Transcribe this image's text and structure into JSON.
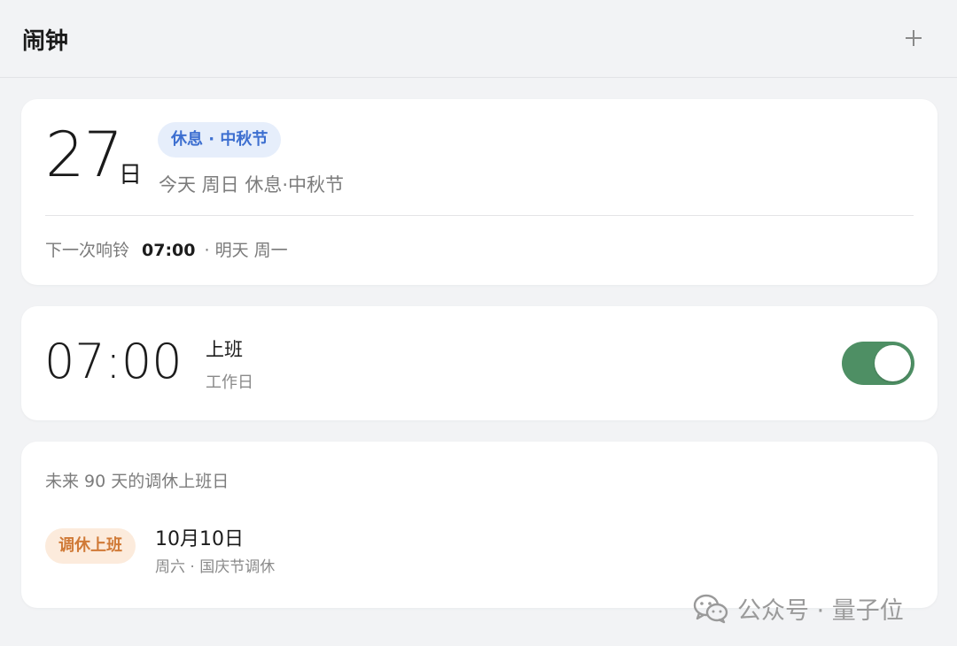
{
  "header": {
    "title": "闹钟",
    "add_icon": "plus-icon"
  },
  "today": {
    "day_number": "27",
    "day_suffix": "日",
    "badge": "休息 · 中秋节",
    "description": "今天 周日 休息·中秋节",
    "next_ring_label": "下一次响铃",
    "next_ring_time": "07:00",
    "next_ring_when": "· 明天 周一"
  },
  "alarm": {
    "time": "07:00",
    "label": "上班",
    "repeat": "工作日",
    "enabled": true,
    "toggle_color": "#4e8f64"
  },
  "makeup": {
    "heading": "未来 90 天的调休上班日",
    "items": [
      {
        "badge": "调休上班",
        "date": "10月10日",
        "detail": "周六 · 国庆节调休"
      }
    ]
  },
  "watermark": {
    "text": "公众号 · 量子位",
    "icon": "wechat-icon"
  },
  "colors": {
    "holiday_badge_bg": "#e6eefb",
    "holiday_badge_text": "#3d6fd0",
    "makeup_badge_bg": "#fcebdc",
    "makeup_badge_text": "#d07a37"
  }
}
